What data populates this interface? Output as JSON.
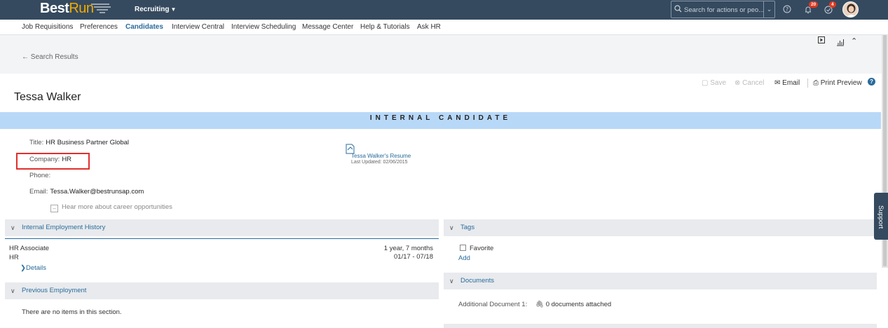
{
  "topbar": {
    "logo_best": "Best",
    "logo_run": "Run",
    "module": "Recruiting",
    "search_placeholder": "Search for actions or peo...",
    "notifications_count": "20",
    "approvals_count": "4"
  },
  "nav": {
    "items": [
      "Job Requisitions",
      "Preferences",
      "Candidates",
      "Interview Central",
      "Interview Scheduling",
      "Message Center",
      "Help & Tutorials",
      "Ask HR"
    ],
    "active": "Candidates"
  },
  "subheader": {
    "back_label": "Search Results"
  },
  "toolbar": {
    "save": "Save",
    "cancel": "Cancel",
    "email": "Email",
    "print_preview": "Print Preview"
  },
  "candidate": {
    "name": "Tessa Walker",
    "banner": "INTERNAL CANDIDATE",
    "title_label": "Title:",
    "title_value": "HR Business Partner Global",
    "company_label": "Company:",
    "company_value": "HR",
    "phone_label": "Phone:",
    "phone_value": "",
    "email_label": "Email:",
    "email_value": "Tessa.Walker@bestrunsap.com",
    "career_checkbox": "Hear more about career opportunities",
    "resume_link": "Tessa Walker's Resume",
    "resume_updated": "Last Updated: 02/06/2015"
  },
  "internal_history": {
    "title": "Internal Employment History",
    "role": "HR Associate",
    "department": "HR",
    "duration": "1 year, 7 months",
    "dates": "01/17 - 07/18",
    "details_link": "Details"
  },
  "previous_employment": {
    "title": "Previous Employment",
    "empty_text": "There are no items in this section."
  },
  "tags": {
    "title": "Tags",
    "favorite_label": "Favorite",
    "add_link": "Add"
  },
  "documents": {
    "title": "Documents",
    "label": "Additional Document 1:",
    "value": "0 documents attached"
  },
  "support_tab": "Support"
}
